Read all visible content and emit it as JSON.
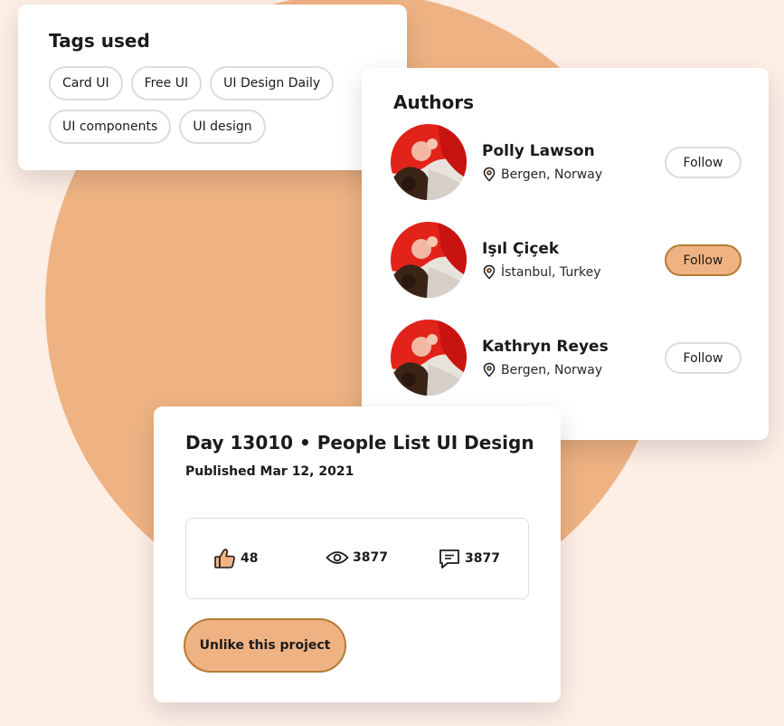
{
  "colors": {
    "background": "#fdeee6",
    "accent": "#efb383",
    "accent_border": "#b57a35",
    "card": "#ffffff"
  },
  "tags_card": {
    "title": "Tags used",
    "tags": [
      "Card UI",
      "Free UI",
      "UI Design Daily",
      "UI components",
      "UI design"
    ]
  },
  "authors_card": {
    "title": "Authors",
    "authors": [
      {
        "name": "Polly Lawson",
        "location": "Bergen, Norway",
        "follow_label": "Follow",
        "following": false,
        "location_icon": "map-pin-icon"
      },
      {
        "name": "Işıl Çiçek",
        "location": "İstanbul, Turkey",
        "follow_label": "Follow",
        "following": true,
        "location_icon": "map-pin-icon"
      },
      {
        "name": "Kathryn Reyes",
        "location": "Bergen, Norway",
        "follow_label": "Follow",
        "following": false,
        "location_icon": "map-pin-icon"
      }
    ]
  },
  "project_card": {
    "title": "Day 13010 • People List UI Design",
    "published": "Published Mar 12, 2021",
    "stats": {
      "likes": "48",
      "views": "3877",
      "comments": "3877"
    },
    "icons": {
      "likes": "thumbs-up-icon",
      "views": "eye-icon",
      "comments": "comment-icon"
    },
    "unlike_label": "Unlike this project"
  }
}
